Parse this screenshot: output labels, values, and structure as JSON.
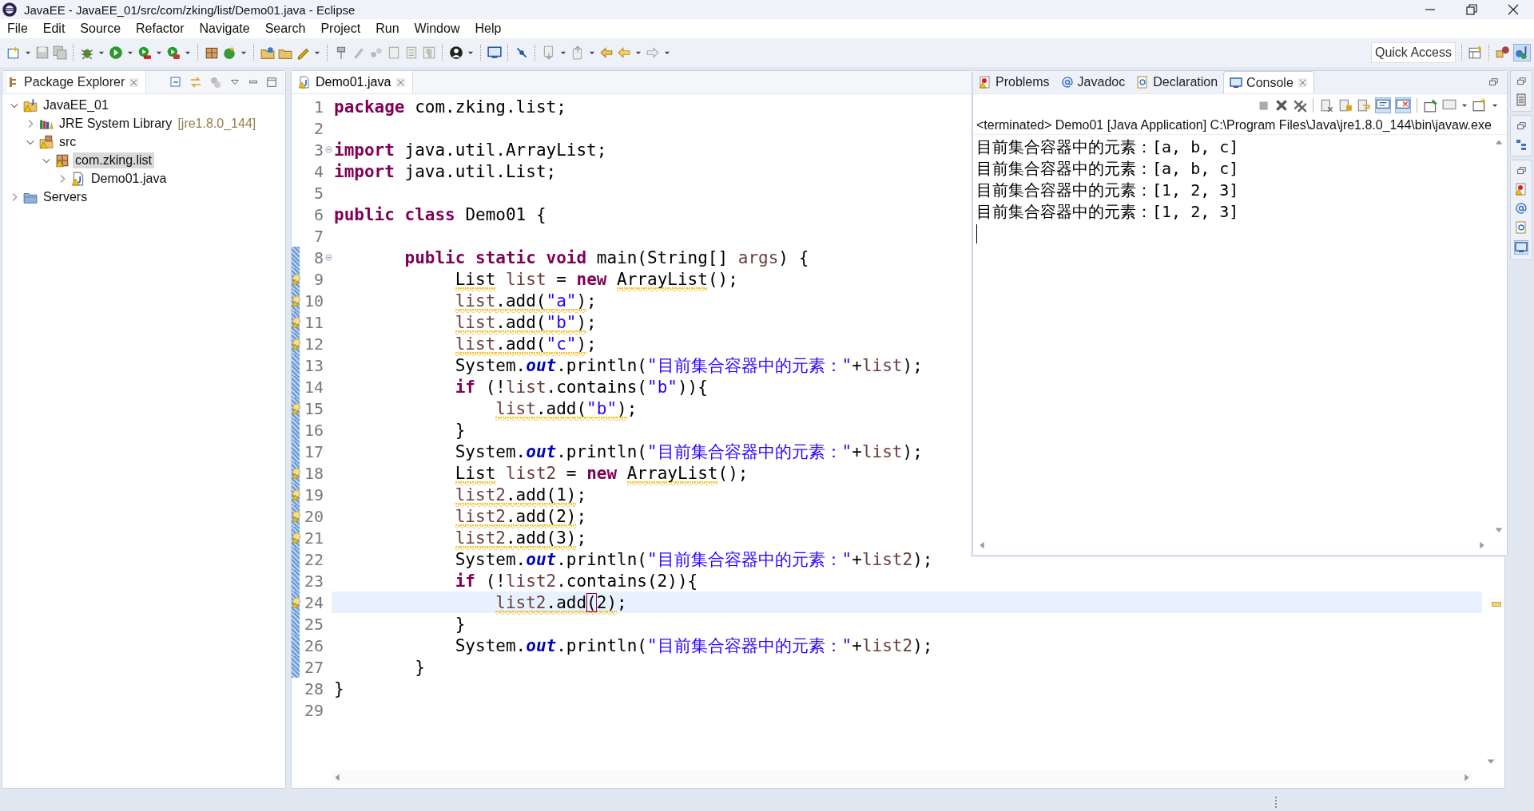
{
  "window": {
    "title": "JavaEE - JavaEE_01/src/com/zking/list/Demo01.java - Eclipse"
  },
  "menu": [
    "File",
    "Edit",
    "Source",
    "Refactor",
    "Navigate",
    "Search",
    "Project",
    "Run",
    "Window",
    "Help"
  ],
  "quick_access": {
    "label": "Quick Access"
  },
  "package_explorer": {
    "title": "Package Explorer",
    "tree": [
      {
        "label": "JavaEE_01",
        "kind": "project",
        "warning": true,
        "expanded": true,
        "selected": false,
        "children": [
          {
            "label": "JRE System Library",
            "decoration": "[jre1.8.0_144]",
            "kind": "library",
            "warning": false,
            "expanded": false,
            "selected": false
          },
          {
            "label": "src",
            "kind": "source-folder",
            "warning": true,
            "expanded": true,
            "selected": false,
            "children": [
              {
                "label": "com.zking.list",
                "kind": "package",
                "warning": true,
                "expanded": true,
                "selected": true,
                "children": [
                  {
                    "label": "Demo01.java",
                    "kind": "java-file",
                    "warning": true,
                    "expanded": false,
                    "selected": false
                  }
                ]
              }
            ]
          }
        ]
      },
      {
        "label": "Servers",
        "kind": "folder",
        "warning": false,
        "expanded": false,
        "selected": false
      }
    ]
  },
  "editor": {
    "tab": {
      "label": "Demo01.java",
      "selected": true
    },
    "lines": [
      {
        "number": "1",
        "warning": false,
        "current": false,
        "fold": false,
        "changed": false,
        "tokens": [
          {
            "kind": "kw",
            "text": "package",
            "warn": false
          },
          {
            "kind": "plain",
            "text": " com.zking.list;",
            "warn": false
          }
        ]
      },
      {
        "number": "2",
        "warning": false,
        "current": false,
        "fold": false,
        "changed": false
      },
      {
        "number": "3",
        "warning": false,
        "current": false,
        "fold": true,
        "changed": false,
        "tokens": [
          {
            "kind": "kw",
            "text": "import",
            "warn": false
          },
          {
            "kind": "plain",
            "text": " java.util.ArrayList;",
            "warn": false
          }
        ]
      },
      {
        "number": "4",
        "warning": false,
        "current": false,
        "fold": false,
        "changed": false,
        "tokens": [
          {
            "kind": "kw",
            "text": "import",
            "warn": false
          },
          {
            "kind": "plain",
            "text": " java.util.List;",
            "warn": false
          }
        ]
      },
      {
        "number": "5",
        "warning": false,
        "current": false,
        "fold": false,
        "changed": false
      },
      {
        "number": "6",
        "warning": false,
        "current": false,
        "fold": false,
        "changed": false,
        "tokens": [
          {
            "kind": "kw",
            "text": "public class",
            "warn": false
          },
          {
            "kind": "plain",
            "text": " Demo01 {",
            "warn": false
          }
        ]
      },
      {
        "number": "7",
        "warning": false,
        "current": false,
        "fold": false,
        "changed": false
      },
      {
        "number": "8",
        "warning": false,
        "current": false,
        "fold": true,
        "changed": true,
        "tokens": [
          {
            "kind": "kw",
            "text": "       public static void",
            "warn": false
          },
          {
            "kind": "plain",
            "text": " main(String[] ",
            "warn": false
          },
          {
            "kind": "var",
            "text": "args",
            "warn": false
          },
          {
            "kind": "plain",
            "text": ") {",
            "warn": false
          }
        ]
      },
      {
        "number": "9",
        "warning": true,
        "current": false,
        "fold": false,
        "changed": true,
        "tokens": [
          {
            "kind": "plain",
            "text": "            List",
            "warn": true
          },
          {
            "kind": "var",
            "text": " list",
            "warn": false
          },
          {
            "kind": "plain",
            "text": " = ",
            "warn": false
          },
          {
            "kind": "kw",
            "text": "new",
            "warn": false
          },
          {
            "kind": "plain",
            "text": " ArrayList",
            "warn": true
          },
          {
            "kind": "plain",
            "text": "();",
            "warn": false
          }
        ]
      },
      {
        "number": "10",
        "warning": true,
        "current": false,
        "fold": false,
        "changed": true,
        "tokens": [
          {
            "kind": "var",
            "text": "            list",
            "warn": true
          },
          {
            "kind": "plain",
            "text": ".add(",
            "warn": true
          },
          {
            "kind": "str",
            "text": "\"a\"",
            "warn": true
          },
          {
            "kind": "plain",
            "text": ")",
            "warn": true
          },
          {
            "kind": "plain",
            "text": ";",
            "warn": false
          }
        ]
      },
      {
        "number": "11",
        "warning": true,
        "current": false,
        "fold": false,
        "changed": true,
        "tokens": [
          {
            "kind": "var",
            "text": "            list",
            "warn": true
          },
          {
            "kind": "plain",
            "text": ".add(",
            "warn": true
          },
          {
            "kind": "str",
            "text": "\"b\"",
            "warn": true
          },
          {
            "kind": "plain",
            "text": ")",
            "warn": true
          },
          {
            "kind": "plain",
            "text": ";",
            "warn": false
          }
        ]
      },
      {
        "number": "12",
        "warning": true,
        "current": false,
        "fold": false,
        "changed": true,
        "tokens": [
          {
            "kind": "var",
            "text": "            list",
            "warn": true
          },
          {
            "kind": "plain",
            "text": ".add(",
            "warn": true
          },
          {
            "kind": "str",
            "text": "\"c\"",
            "warn": true
          },
          {
            "kind": "plain",
            "text": ")",
            "warn": true
          },
          {
            "kind": "plain",
            "text": ";",
            "warn": false
          }
        ]
      },
      {
        "number": "13",
        "warning": false,
        "current": false,
        "fold": false,
        "changed": true,
        "tokens": [
          {
            "kind": "plain",
            "text": "            System.",
            "warn": false
          },
          {
            "kind": "field",
            "text": "out",
            "warn": false
          },
          {
            "kind": "plain",
            "text": ".println(",
            "warn": false
          },
          {
            "kind": "str",
            "text": "\"目前集合容器中的元素：\"",
            "warn": false
          },
          {
            "kind": "plain",
            "text": "+",
            "warn": false
          },
          {
            "kind": "var",
            "text": "list",
            "warn": false
          },
          {
            "kind": "plain",
            "text": ");",
            "warn": false
          }
        ]
      },
      {
        "number": "14",
        "warning": false,
        "current": false,
        "fold": false,
        "changed": true,
        "tokens": [
          {
            "kind": "kw",
            "text": "            if",
            "warn": false
          },
          {
            "kind": "plain",
            "text": " (!",
            "warn": false
          },
          {
            "kind": "var",
            "text": "list",
            "warn": false
          },
          {
            "kind": "plain",
            "text": ".contains(",
            "warn": false
          },
          {
            "kind": "str",
            "text": "\"b\"",
            "warn": false
          },
          {
            "kind": "plain",
            "text": ")){",
            "warn": false
          }
        ]
      },
      {
        "number": "15",
        "warning": true,
        "current": false,
        "fold": false,
        "changed": true,
        "tokens": [
          {
            "kind": "var",
            "text": "                list",
            "warn": true
          },
          {
            "kind": "plain",
            "text": ".add(",
            "warn": true
          },
          {
            "kind": "str",
            "text": "\"b\"",
            "warn": true
          },
          {
            "kind": "plain",
            "text": ")",
            "warn": true
          },
          {
            "kind": "plain",
            "text": ";",
            "warn": false
          }
        ]
      },
      {
        "number": "16",
        "warning": false,
        "current": false,
        "fold": false,
        "changed": true,
        "tokens": [
          {
            "kind": "plain",
            "text": "            }",
            "warn": false
          }
        ]
      },
      {
        "number": "17",
        "warning": false,
        "current": false,
        "fold": false,
        "changed": true,
        "tokens": [
          {
            "kind": "plain",
            "text": "            System.",
            "warn": false
          },
          {
            "kind": "field",
            "text": "out",
            "warn": false
          },
          {
            "kind": "plain",
            "text": ".println(",
            "warn": false
          },
          {
            "kind": "str",
            "text": "\"目前集合容器中的元素：\"",
            "warn": false
          },
          {
            "kind": "plain",
            "text": "+",
            "warn": false
          },
          {
            "kind": "var",
            "text": "list",
            "warn": false
          },
          {
            "kind": "plain",
            "text": ");",
            "warn": false
          }
        ]
      },
      {
        "number": "18",
        "warning": true,
        "current": false,
        "fold": false,
        "changed": true,
        "tokens": [
          {
            "kind": "plain",
            "text": "            List",
            "warn": true
          },
          {
            "kind": "var",
            "text": " list2",
            "warn": false
          },
          {
            "kind": "plain",
            "text": " = ",
            "warn": false
          },
          {
            "kind": "kw",
            "text": "new",
            "warn": false
          },
          {
            "kind": "plain",
            "text": " ArrayList",
            "warn": true
          },
          {
            "kind": "plain",
            "text": "();",
            "warn": false
          }
        ]
      },
      {
        "number": "19",
        "warning": true,
        "current": false,
        "fold": false,
        "changed": true,
        "tokens": [
          {
            "kind": "var",
            "text": "            list2",
            "warn": true
          },
          {
            "kind": "plain",
            "text": ".add(1)",
            "warn": true
          },
          {
            "kind": "plain",
            "text": ";",
            "warn": false
          }
        ]
      },
      {
        "number": "20",
        "warning": true,
        "current": false,
        "fold": false,
        "changed": true,
        "tokens": [
          {
            "kind": "var",
            "text": "            list2",
            "warn": true
          },
          {
            "kind": "plain",
            "text": ".add(2)",
            "warn": true
          },
          {
            "kind": "plain",
            "text": ";",
            "warn": false
          }
        ]
      },
      {
        "number": "21",
        "warning": true,
        "current": false,
        "fold": false,
        "changed": true,
        "tokens": [
          {
            "kind": "var",
            "text": "            list2",
            "warn": true
          },
          {
            "kind": "plain",
            "text": ".add(3)",
            "warn": true
          },
          {
            "kind": "plain",
            "text": ";",
            "warn": false
          }
        ]
      },
      {
        "number": "22",
        "warning": false,
        "current": false,
        "fold": false,
        "changed": true,
        "tokens": [
          {
            "kind": "plain",
            "text": "            System.",
            "warn": false
          },
          {
            "kind": "field",
            "text": "out",
            "warn": false
          },
          {
            "kind": "plain",
            "text": ".println(",
            "warn": false
          },
          {
            "kind": "str",
            "text": "\"目前集合容器中的元素：\"",
            "warn": false
          },
          {
            "kind": "plain",
            "text": "+",
            "warn": false
          },
          {
            "kind": "var",
            "text": "list2",
            "warn": false
          },
          {
            "kind": "plain",
            "text": ");",
            "warn": false
          }
        ]
      },
      {
        "number": "23",
        "warning": false,
        "current": false,
        "fold": false,
        "changed": true,
        "tokens": [
          {
            "kind": "kw",
            "text": "            if",
            "warn": false
          },
          {
            "kind": "plain",
            "text": " (!",
            "warn": false
          },
          {
            "kind": "var",
            "text": "list2",
            "warn": false
          },
          {
            "kind": "plain",
            "text": ".contains(2)){",
            "warn": false
          }
        ]
      },
      {
        "number": "24",
        "warning": true,
        "current": true,
        "fold": false,
        "changed": true,
        "tokens": [
          {
            "kind": "var",
            "text": "                list2",
            "warn": true
          },
          {
            "kind": "plain",
            "text": ".add",
            "warn": true
          },
          {
            "kind": "bracket",
            "text": "(",
            "warn": true
          },
          {
            "kind": "plain",
            "text": "2)",
            "warn": true
          },
          {
            "kind": "plain",
            "text": ";",
            "warn": false
          }
        ]
      },
      {
        "number": "25",
        "warning": false,
        "current": false,
        "fold": false,
        "changed": true,
        "tokens": [
          {
            "kind": "plain",
            "text": "            }",
            "warn": false
          }
        ]
      },
      {
        "number": "26",
        "warning": false,
        "current": false,
        "fold": false,
        "changed": true,
        "tokens": [
          {
            "kind": "plain",
            "text": "            System.",
            "warn": false
          },
          {
            "kind": "field",
            "text": "out",
            "warn": false
          },
          {
            "kind": "plain",
            "text": ".println(",
            "warn": false
          },
          {
            "kind": "str",
            "text": "\"目前集合容器中的元素：\"",
            "warn": false
          },
          {
            "kind": "plain",
            "text": "+",
            "warn": false
          },
          {
            "kind": "var",
            "text": "list2",
            "warn": false
          },
          {
            "kind": "plain",
            "text": ");",
            "warn": false
          }
        ]
      },
      {
        "number": "27",
        "warning": false,
        "current": false,
        "fold": false,
        "changed": true,
        "tokens": [
          {
            "kind": "plain",
            "text": "        }",
            "warn": false
          }
        ]
      },
      {
        "number": "28",
        "warning": false,
        "current": false,
        "fold": false,
        "changed": false,
        "tokens": [
          {
            "kind": "plain",
            "text": "}",
            "warn": false
          }
        ]
      },
      {
        "number": "29",
        "warning": false,
        "current": false,
        "fold": false,
        "changed": false
      }
    ]
  },
  "console_view": {
    "tabs": [
      {
        "label": "Problems",
        "kind": "problems",
        "selected": false
      },
      {
        "label": "Javadoc",
        "kind": "javadoc",
        "selected": false
      },
      {
        "label": "Declaration",
        "kind": "declaration",
        "selected": false
      },
      {
        "label": "Console",
        "kind": "console",
        "selected": true
      }
    ],
    "header": "<terminated> Demo01 [Java Application] C:\\Program Files\\Java\\jre1.8.0_144\\bin\\javaw.exe",
    "output": [
      "目前集合容器中的元素：[a, b, c]",
      "目前集合容器中的元素：[a, b, c]",
      "目前集合容器中的元素：[1, 2, 3]",
      "目前集合容器中的元素：[1, 2, 3]"
    ]
  }
}
